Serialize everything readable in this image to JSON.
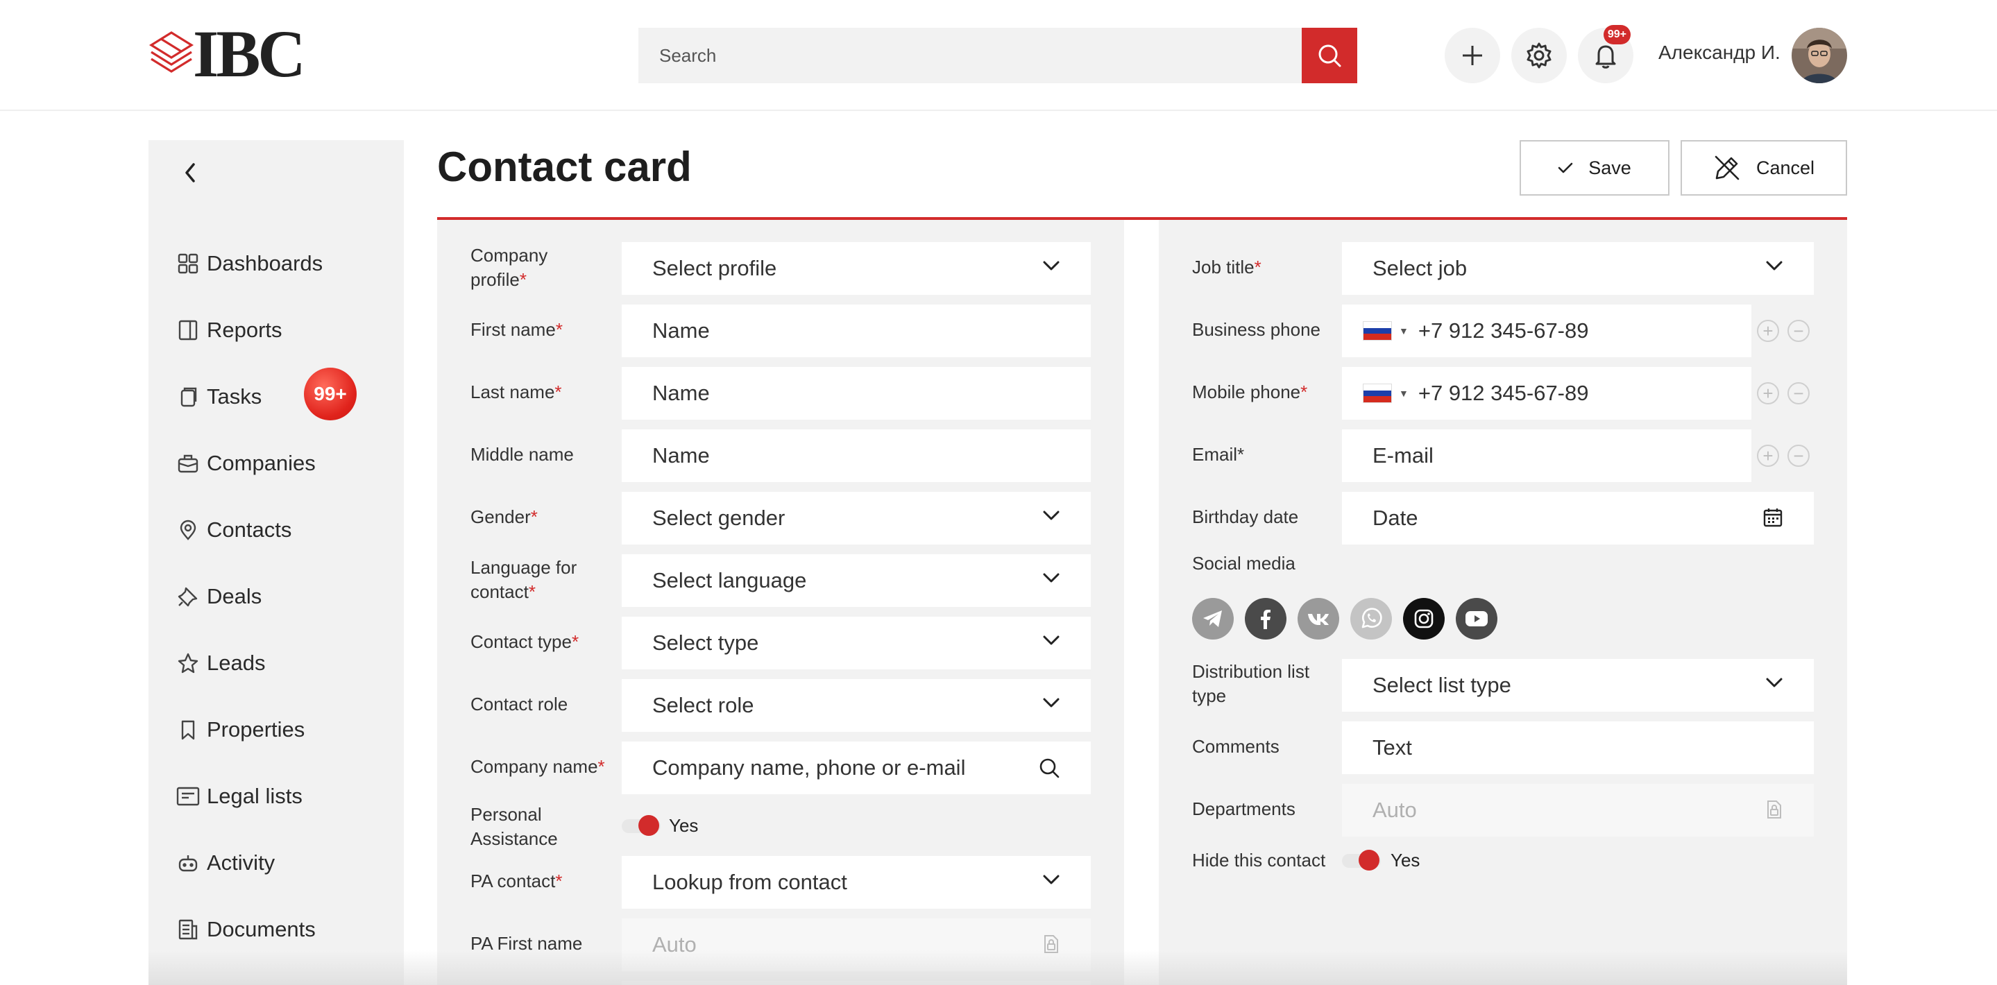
{
  "brand": {
    "logo_text": "IBC",
    "accent_color": "#d22b2b"
  },
  "header": {
    "search_placeholder": "Search",
    "add_icon": "plus-icon",
    "settings_icon": "gear-icon",
    "notifications": {
      "icon": "bell-icon",
      "badge": "99+"
    },
    "user_name": "Александр И."
  },
  "sidebar": {
    "back_icon": "chevron-left-icon",
    "items": [
      {
        "label": "Dashboards",
        "icon": "grid-icon"
      },
      {
        "label": "Reports",
        "icon": "report-icon"
      },
      {
        "label": "Tasks",
        "icon": "tasks-icon",
        "badge": "99+"
      },
      {
        "label": "Companies",
        "icon": "briefcase-icon"
      },
      {
        "label": "Contacts",
        "icon": "location-pin-icon"
      },
      {
        "label": "Deals",
        "icon": "pin-icon"
      },
      {
        "label": "Leads",
        "icon": "star-icon"
      },
      {
        "label": "Properties",
        "icon": "bookmark-icon"
      },
      {
        "label": "Legal lists",
        "icon": "list-card-icon"
      },
      {
        "label": "Activity",
        "icon": "robot-icon"
      },
      {
        "label": "Documents",
        "icon": "document-icon"
      }
    ]
  },
  "main": {
    "title": "Contact card",
    "save_label": "Save",
    "cancel_label": "Cancel"
  },
  "left_form": {
    "company_profile": {
      "label_1": "Company",
      "label_2": "profile",
      "value": "Select profile"
    },
    "first_name": {
      "label": "First name",
      "placeholder": "Name"
    },
    "last_name": {
      "label": "Last name",
      "placeholder": "Name"
    },
    "middle_name": {
      "label": "Middle name",
      "placeholder": "Name"
    },
    "gender": {
      "label": "Gender",
      "value": "Select gender"
    },
    "language": {
      "label_1": "Language for",
      "label_2": "contact",
      "value": "Select language"
    },
    "contact_type": {
      "label": "Contact type",
      "value": "Select type"
    },
    "contact_role": {
      "label": "Contact role",
      "value": "Select role"
    },
    "company_name": {
      "label": "Company name",
      "placeholder": "Company name, phone or e-mail"
    },
    "personal_assistance": {
      "label_1": "Personal",
      "label_2": "Assistance",
      "toggle_label": "Yes"
    },
    "pa_contact": {
      "label": "PA contact",
      "value": "Lookup from contact"
    },
    "pa_first_name": {
      "label": "PA First name",
      "value": "Auto"
    }
  },
  "right_form": {
    "job_title": {
      "label": "Job title",
      "value": "Select job"
    },
    "business_phone": {
      "label": "Business phone",
      "value": "+7 912 345-67-89"
    },
    "mobile_phone": {
      "label": "Mobile phone",
      "value": "+7 912 345-67-89"
    },
    "email": {
      "label": "Email*",
      "placeholder": "E-mail"
    },
    "birthday": {
      "label": "Birthday date",
      "placeholder": "Date"
    },
    "social_media": {
      "label": "Social media",
      "icons": [
        "telegram-icon",
        "facebook-icon",
        "vk-icon",
        "whatsapp-icon",
        "instagram-icon",
        "youtube-icon"
      ]
    },
    "distribution_list": {
      "label_1": "Distribution list",
      "label_2": "type",
      "value": "Select list type"
    },
    "comments": {
      "label": "Comments",
      "placeholder": "Text"
    },
    "departments": {
      "label": "Departments",
      "value": "Auto"
    },
    "hide_contact": {
      "label": "Hide this contact",
      "toggle_label": "Yes"
    }
  },
  "required_mark": "*"
}
